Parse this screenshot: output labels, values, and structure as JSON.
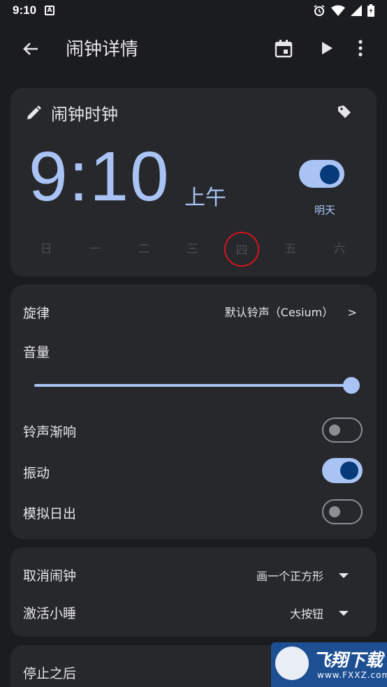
{
  "status_bar": {
    "time": "9:10",
    "notification_icon": "A"
  },
  "app_bar": {
    "title": "闹钟详情"
  },
  "alarm": {
    "label": "闹钟时钟",
    "time_hour": "9",
    "time_minute": "10",
    "ampm": "上午",
    "enabled": true,
    "next": "明天",
    "days": [
      "日",
      "一",
      "二",
      "三",
      "四",
      "五",
      "六"
    ],
    "selected_day_index": 4
  },
  "settings": {
    "ringtone_label": "旋律",
    "ringtone_value": "默认铃声（Cesium）",
    "ringtone_chevron": ">",
    "volume_label": "音量",
    "volume_level": 1.0,
    "fade_label": "铃声渐响",
    "fade_on": false,
    "vibrate_label": "振动",
    "vibrate_on": true,
    "sunrise_label": "模拟日出",
    "sunrise_on": false
  },
  "dismiss": {
    "cancel_label": "取消闹钟",
    "cancel_value": "画一个正方形",
    "snooze_label": "激活小睡",
    "snooze_value": "大按钮"
  },
  "after": {
    "label": "停止之后"
  },
  "watermark": {
    "text": "飞翔下载",
    "url": "www.FXXZ.com"
  },
  "colors": {
    "accent": "#a9c3f5",
    "accent_dark": "#063a78",
    "card": "#26282c",
    "background": "#1b1c1f"
  }
}
